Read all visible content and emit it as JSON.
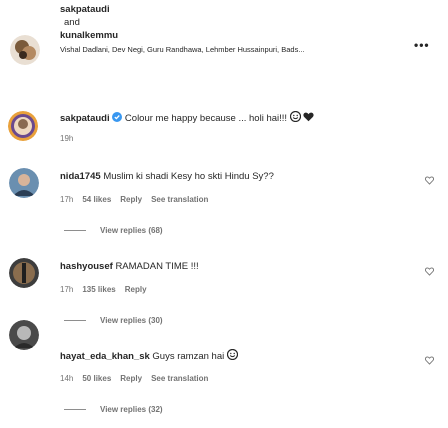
{
  "header_post": {
    "line1": "sakpataudi",
    "line2": "and",
    "line3": "kunalkemmu",
    "tagged": "Vishal Dadlani, Dev Negi, Guru Randhawa, Lehmber Hussainpuri, Bads...",
    "more_label": "•••"
  },
  "caption": {
    "username": "sakpataudi",
    "text": "Colour me happy because ... holi hai!!!",
    "time": "19h",
    "verified_icon": "verified-badge-icon"
  },
  "comments": [
    {
      "username": "nida1745",
      "text": "Muslim ki shadi Kesy ho skti Hindu Sy??",
      "time": "17h",
      "likes": "54 likes",
      "reply": "Reply",
      "translate": "See translation",
      "view_replies": "View replies (68)"
    },
    {
      "username": "hashyousef",
      "text": "RAMADAN TIME !!!",
      "time": "17h",
      "likes": "135 likes",
      "reply": "Reply",
      "view_replies": "View replies (30)"
    },
    {
      "username": "hayat_eda_khan_sk",
      "text": "Guys ramzan hai",
      "time": "14h",
      "likes": "50 likes",
      "reply": "Reply",
      "translate": "See translation",
      "view_replies": "View replies (32)"
    }
  ]
}
